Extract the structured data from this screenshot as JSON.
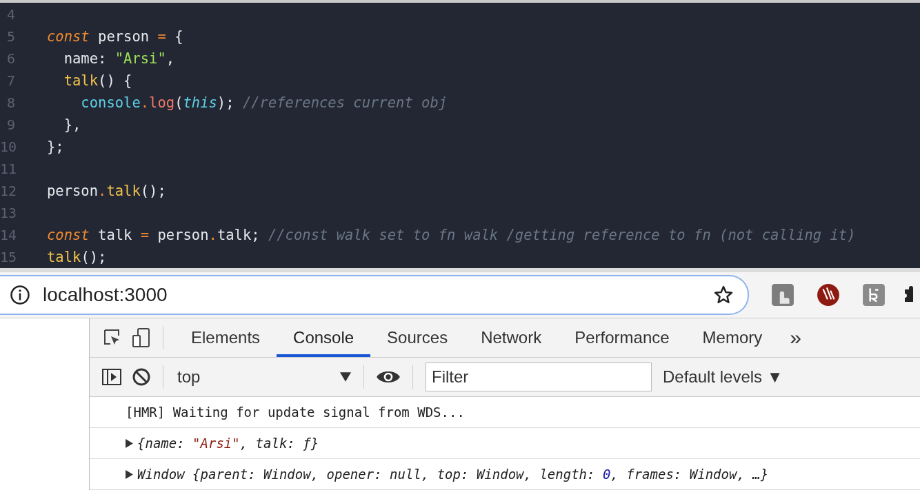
{
  "editor": {
    "lines": [
      {
        "number": "4"
      },
      {
        "number": "5",
        "tokens": [
          {
            "text": "const",
            "kind": "keyword"
          },
          {
            "text": " person ",
            "kind": "plain"
          },
          {
            "text": "=",
            "kind": "operator"
          },
          {
            "text": " {",
            "kind": "plain"
          }
        ]
      },
      {
        "number": "6",
        "tokens": [
          {
            "text": "  name: ",
            "kind": "plain"
          },
          {
            "text": "\"Arsi\"",
            "kind": "string"
          },
          {
            "text": ",",
            "kind": "plain"
          }
        ]
      },
      {
        "number": "7",
        "tokens": [
          {
            "text": "  talk",
            "kind": "function"
          },
          {
            "text": "() {",
            "kind": "plain"
          }
        ]
      },
      {
        "number": "8",
        "tokens": [
          {
            "text": "    console",
            "kind": "builtin"
          },
          {
            "text": ".",
            "kind": "operator"
          },
          {
            "text": "log",
            "kind": "method"
          },
          {
            "text": "(",
            "kind": "plain"
          },
          {
            "text": "this",
            "kind": "this"
          },
          {
            "text": "); ",
            "kind": "plain"
          },
          {
            "text": "//references current obj",
            "kind": "comment"
          }
        ]
      },
      {
        "number": "9",
        "tokens": [
          {
            "text": "  },",
            "kind": "plain"
          }
        ]
      },
      {
        "number": "10",
        "tokens": [
          {
            "text": "};",
            "kind": "plain"
          }
        ]
      },
      {
        "number": "11"
      },
      {
        "number": "12",
        "tokens": [
          {
            "text": "person",
            "kind": "plain"
          },
          {
            "text": ".",
            "kind": "operator"
          },
          {
            "text": "talk",
            "kind": "function"
          },
          {
            "text": "();",
            "kind": "plain"
          }
        ]
      },
      {
        "number": "13"
      },
      {
        "number": "14",
        "tokens": [
          {
            "text": "const",
            "kind": "keyword"
          },
          {
            "text": " talk ",
            "kind": "plain"
          },
          {
            "text": "=",
            "kind": "operator"
          },
          {
            "text": " person",
            "kind": "plain"
          },
          {
            "text": ".",
            "kind": "operator"
          },
          {
            "text": "talk; ",
            "kind": "plain"
          },
          {
            "text": "//const walk set to fn walk /getting reference to fn (not calling it)",
            "kind": "comment"
          }
        ]
      },
      {
        "number": "15",
        "tokens": [
          {
            "text": "talk",
            "kind": "function"
          },
          {
            "text": "();",
            "kind": "plain"
          }
        ]
      }
    ]
  },
  "address_bar": {
    "url": "localhost:3000"
  },
  "devtools": {
    "tabs": [
      {
        "label": "Elements",
        "selected": false
      },
      {
        "label": "Console",
        "selected": true
      },
      {
        "label": "Sources",
        "selected": false
      },
      {
        "label": "Network",
        "selected": false
      },
      {
        "label": "Performance",
        "selected": false
      },
      {
        "label": "Memory",
        "selected": false
      }
    ],
    "more_tabs": "»",
    "context": "top",
    "filter": {
      "placeholder": "Filter"
    },
    "levels": "Default levels ▼",
    "messages": [
      {
        "expandable": false,
        "tokens": [
          {
            "text": "[HMR] Waiting for update signal from WDS...",
            "kind": "plain"
          }
        ]
      },
      {
        "expandable": true,
        "tokens": [
          {
            "text": "{name: ",
            "kind": "italic"
          },
          {
            "text": "\"Arsi\"",
            "kind": "string"
          },
          {
            "text": ", talk: ƒ}",
            "kind": "italic"
          }
        ]
      },
      {
        "expandable": true,
        "tokens": [
          {
            "text": "Window {parent: Window, opener: null, top: Window, length: ",
            "kind": "italic"
          },
          {
            "text": "0",
            "kind": "number"
          },
          {
            "text": ", frames: Window, …}",
            "kind": "italic"
          }
        ]
      }
    ]
  }
}
